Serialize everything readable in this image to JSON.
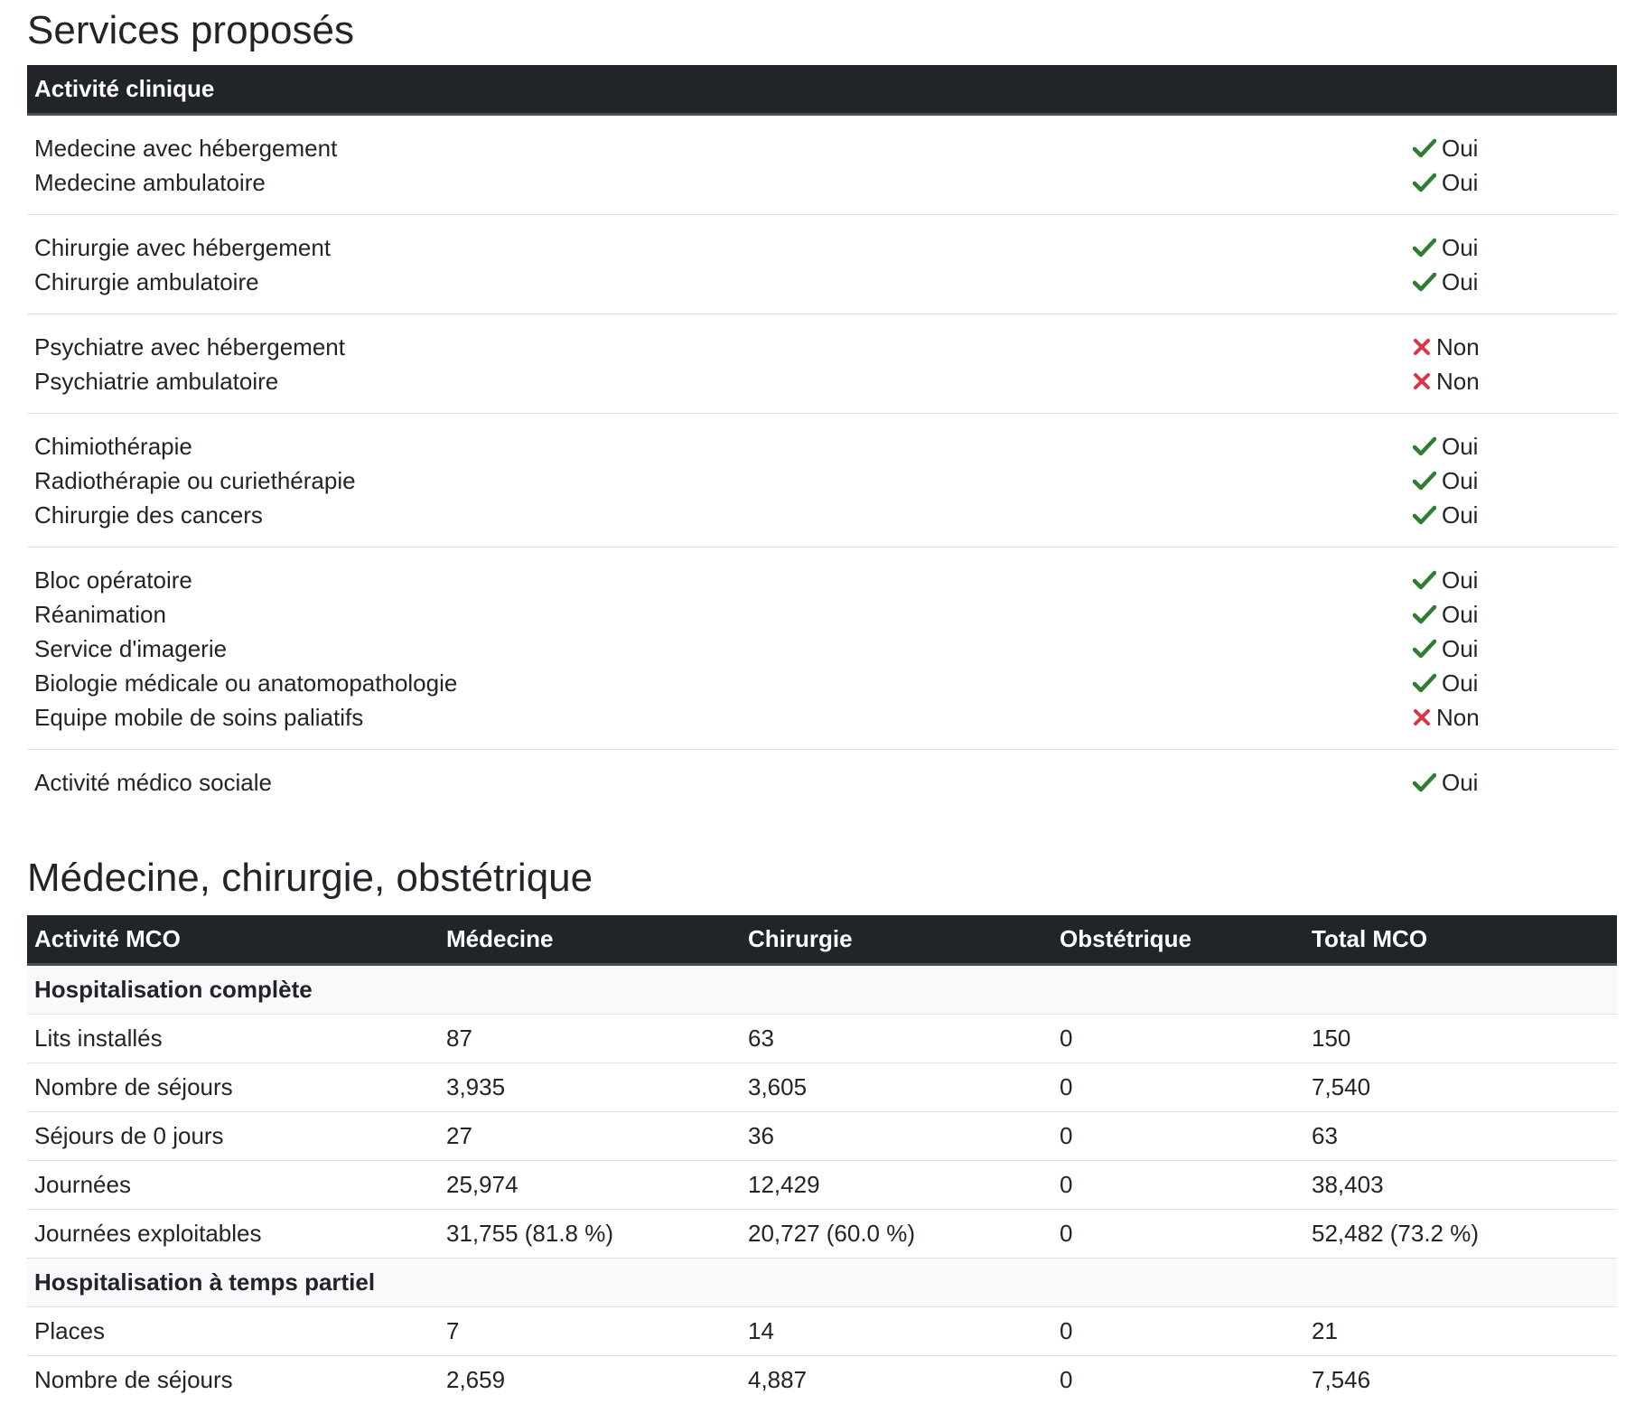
{
  "services": {
    "title": "Services proposés",
    "header": "Activité clinique",
    "groups": [
      {
        "items": [
          {
            "label": "Medecine avec hébergement",
            "status": "Oui",
            "icon": "check-icon"
          },
          {
            "label": "Medecine ambulatoire",
            "status": "Oui",
            "icon": "check-icon"
          }
        ]
      },
      {
        "items": [
          {
            "label": "Chirurgie avec hébergement",
            "status": "Oui",
            "icon": "check-icon"
          },
          {
            "label": "Chirurgie ambulatoire",
            "status": "Oui",
            "icon": "check-icon"
          }
        ]
      },
      {
        "items": [
          {
            "label": "Psychiatre avec hébergement",
            "status": "Non",
            "icon": "cross-icon"
          },
          {
            "label": "Psychiatrie ambulatoire",
            "status": "Non",
            "icon": "cross-icon"
          }
        ]
      },
      {
        "items": [
          {
            "label": "Chimiothérapie",
            "status": "Oui",
            "icon": "check-icon"
          },
          {
            "label": "Radiothérapie ou curiethérapie",
            "status": "Oui",
            "icon": "check-icon"
          },
          {
            "label": "Chirurgie des cancers",
            "status": "Oui",
            "icon": "check-icon"
          }
        ]
      },
      {
        "items": [
          {
            "label": "Bloc opératoire",
            "status": "Oui",
            "icon": "check-icon"
          },
          {
            "label": "Réanimation",
            "status": "Oui",
            "icon": "check-icon"
          },
          {
            "label": "Service d'imagerie",
            "status": "Oui",
            "icon": "check-icon"
          },
          {
            "label": "Biologie médicale ou anatomopathologie",
            "status": "Oui",
            "icon": "check-icon"
          },
          {
            "label": "Equipe mobile de soins paliatifs",
            "status": "Non",
            "icon": "cross-icon"
          }
        ]
      },
      {
        "items": [
          {
            "label": "Activité médico sociale",
            "status": "Oui",
            "icon": "check-icon"
          }
        ]
      }
    ]
  },
  "mco": {
    "title": "Médecine, chirurgie, obstétrique",
    "columns": [
      "Activité MCO",
      "Médecine",
      "Chirurgie",
      "Obstétrique",
      "Total MCO"
    ],
    "rows": [
      {
        "section": "Hospitalisation complète"
      },
      {
        "cells": [
          "Lits installés",
          "87",
          "63",
          "0",
          "150"
        ]
      },
      {
        "cells": [
          "Nombre de séjours",
          "3,935",
          "3,605",
          "0",
          "7,540"
        ]
      },
      {
        "cells": [
          "Séjours de 0 jours",
          "27",
          "36",
          "0",
          "63"
        ]
      },
      {
        "cells": [
          "Journées",
          "25,974",
          "12,429",
          "0",
          "38,403"
        ]
      },
      {
        "cells": [
          "Journées exploitables",
          "31,755 (81.8 %)",
          "20,727 (60.0 %)",
          "0",
          "52,482 (73.2 %)"
        ]
      },
      {
        "section": "Hospitalisation à temps partiel"
      },
      {
        "cells": [
          "Places",
          "7",
          "14",
          "0",
          "21"
        ]
      },
      {
        "cells": [
          "Nombre de séjours",
          "2,659",
          "4,887",
          "0",
          "7,546"
        ]
      }
    ]
  },
  "colors": {
    "check": "#2f7d32",
    "cross": "#dc3545",
    "header_bg": "#212529"
  }
}
